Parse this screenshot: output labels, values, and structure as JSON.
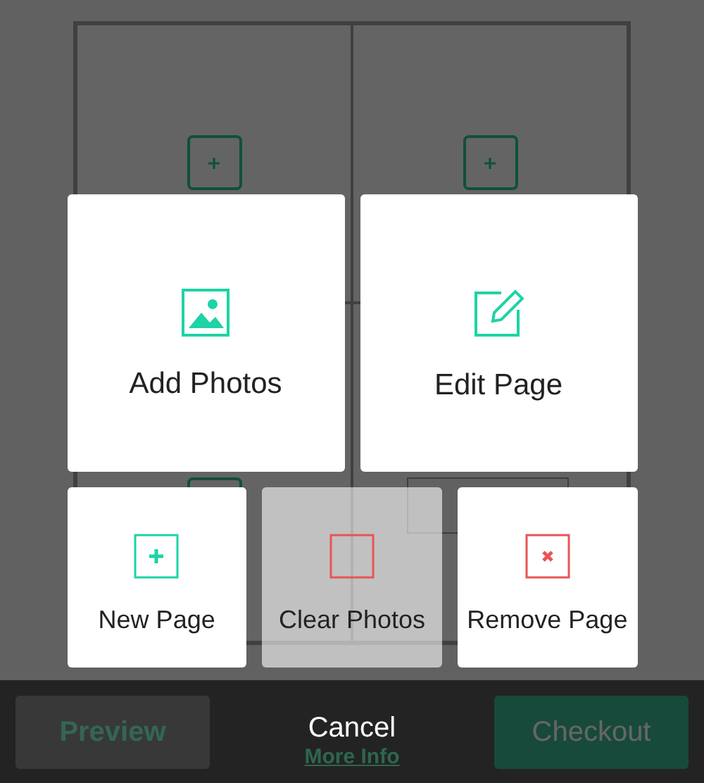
{
  "background": {
    "more_info": "More Info",
    "preview": "Preview",
    "checkout": "Checkout"
  },
  "menu": {
    "large_actions": [
      {
        "label": "Add Photos",
        "kind": "add-photos"
      },
      {
        "label": "Edit Page",
        "kind": "edit"
      }
    ],
    "small_actions": [
      {
        "label": "New Page",
        "kind": "new",
        "disabled": false
      },
      {
        "label": "Clear Photos",
        "kind": "clear",
        "disabled": true
      },
      {
        "label": "Remove Page",
        "kind": "remove",
        "disabled": false
      }
    ],
    "cancel": "Cancel"
  }
}
